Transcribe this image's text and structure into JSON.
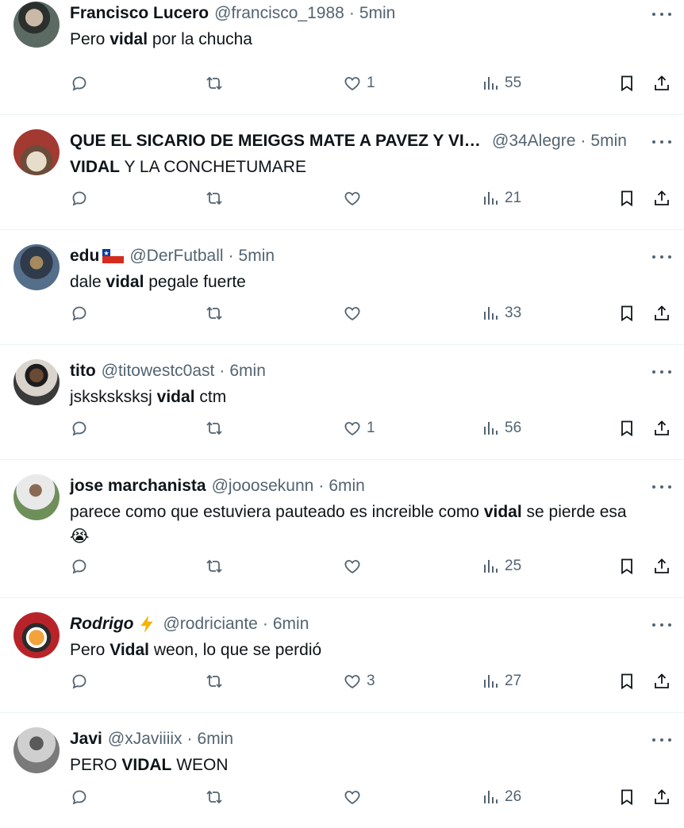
{
  "tweets": [
    {
      "name": "Francisco Lucero",
      "handle": "@francisco_1988",
      "time": "5min",
      "text": [
        "Pero ",
        "vidal",
        " por la chucha"
      ],
      "likes": "1",
      "views": "55",
      "avatar_colors": [
        "#5b6b63",
        "#2b2f2d"
      ]
    },
    {
      "name": "QUE EL SICARIO DE MEIGGS MATE A PAVEZ Y VIDAL",
      "handle": "@34Alegre",
      "time": "5min",
      "text": [
        "VIDAL",
        " Y LA CONCHETUMARE"
      ],
      "likes": "",
      "views": "21",
      "avatar_colors": [
        "#a23a32",
        "#e8dccb"
      ]
    },
    {
      "name": "edu",
      "handle": "@DerFutball",
      "time": "5min",
      "text": [
        "dale ",
        "vidal",
        " pegale fuerte"
      ],
      "likes": "",
      "views": "33",
      "avatar_colors": [
        "#556e8a",
        "#a58a5e"
      ]
    },
    {
      "name": "tito",
      "handle": "@titowestc0ast",
      "time": "6min",
      "text": [
        "jsksksksksj ",
        "vidal",
        " ctm"
      ],
      "likes": "1",
      "views": "56",
      "avatar_colors": [
        "#3a3a3a",
        "#d9d4cc"
      ]
    },
    {
      "name": "jose marchanista",
      "handle": "@jooosekunn",
      "time": "6min",
      "text": [
        "parece como que estuviera pauteado es increible como ",
        "vidal",
        " se pierde esa"
      ],
      "emoji": "😭",
      "likes": "",
      "views": "25",
      "avatar_colors": [
        "#6e8f5a",
        "#e9e9e9"
      ]
    },
    {
      "name": "Rodrigo",
      "handle": "@rodriciante",
      "time": "6min",
      "text": [
        "Pero ",
        "Vidal",
        " weon, lo que se perdió"
      ],
      "likes": "3",
      "views": "27",
      "avatar_colors": [
        "#b8232a",
        "#f2a33a"
      ]
    },
    {
      "name": "Javi",
      "handle": "@xJaviiiix",
      "time": "6min",
      "text": [
        "PERO ",
        "VIDAL",
        " WEON"
      ],
      "likes": "",
      "views": "26",
      "avatar_colors": [
        "#7a7a7a",
        "#cfcfcf"
      ]
    }
  ],
  "colors": {
    "text": "#0f1419",
    "muted": "#536471",
    "border": "#eff3f4",
    "lightning": "#f4b400"
  },
  "icons": [
    "reply-icon",
    "retweet-icon",
    "like-icon",
    "views-icon",
    "bookmark-icon",
    "share-icon",
    "more-icon"
  ]
}
